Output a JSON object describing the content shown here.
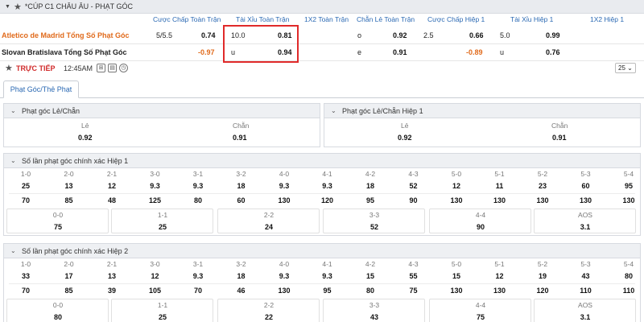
{
  "header": {
    "title": "*CÚP C1 CHÂU ÂU - PHẠT GÓC"
  },
  "columns": [
    "Cược Chấp Toàn Trận",
    "Tài Xỉu Toàn Trận",
    "1X2 Toàn Trận",
    "Chẵn Lẻ Toàn Trận",
    "Cược Chấp Hiệp 1",
    "Tài Xỉu Hiệp 1",
    "1X2 Hiệp 1"
  ],
  "matches": [
    {
      "team": "Atletico de Madrid Tổng Số Phạt Góc",
      "hdp_line": "5/5.5",
      "hdp_odd": "0.74",
      "ou_line": "10.0",
      "ou_odd": "0.81",
      "oe_label": "o",
      "oe_odd": "0.92",
      "h1_hdp_line": "2.5",
      "h1_hdp_odd": "0.66",
      "h1_ou_line": "5.0",
      "h1_ou_odd": "0.99"
    },
    {
      "team": "Slovan Bratislava Tổng Số Phạt Góc",
      "hdp_line": "",
      "hdp_odd": "-0.97",
      "ou_line": "u",
      "ou_odd": "0.94",
      "oe_label": "e",
      "oe_odd": "0.91",
      "h1_hdp_line": "",
      "h1_hdp_odd": "-0.89",
      "h1_ou_line": "u",
      "h1_ou_odd": "0.76"
    }
  ],
  "live": {
    "label": "TRỰC TIẾP",
    "time": "12:45AM",
    "page_size": "25"
  },
  "tab": {
    "label": "Phạt Góc/Thẻ Phạt"
  },
  "panel_oe_full": {
    "title": "Phạt góc Lẻ/Chẵn",
    "odd_label": "Lẻ",
    "even_label": "Chẵn",
    "odd_val": "0.92",
    "even_val": "0.91"
  },
  "panel_oe_h1": {
    "title": "Phạt góc Lẻ/Chẵn Hiệp 1",
    "odd_label": "Lẻ",
    "even_label": "Chẵn",
    "odd_val": "0.92",
    "even_val": "0.91"
  },
  "cs_h1": {
    "title": "Số lần phạt góc chính xác Hiệp 1",
    "headers": [
      "1-0",
      "2-0",
      "2-1",
      "3-0",
      "3-1",
      "3-2",
      "4-0",
      "4-1",
      "4-2",
      "4-3",
      "5-0",
      "5-1",
      "5-2",
      "5-3",
      "5-4"
    ],
    "row1": [
      "25",
      "13",
      "12",
      "9.3",
      "9.3",
      "18",
      "9.3",
      "9.3",
      "18",
      "52",
      "12",
      "11",
      "23",
      "60",
      "95"
    ],
    "row2": [
      "70",
      "85",
      "48",
      "125",
      "80",
      "60",
      "130",
      "120",
      "95",
      "90",
      "130",
      "130",
      "130",
      "130",
      "130"
    ],
    "draw_headers": [
      "0-0",
      "1-1",
      "2-2",
      "3-3",
      "4-4",
      "AOS"
    ],
    "draw_vals": [
      "75",
      "25",
      "24",
      "52",
      "90",
      "3.1"
    ]
  },
  "cs_h2": {
    "title": "Số lần phạt góc chính xác Hiệp 2",
    "headers": [
      "1-0",
      "2-0",
      "2-1",
      "3-0",
      "3-1",
      "3-2",
      "4-0",
      "4-1",
      "4-2",
      "4-3",
      "5-0",
      "5-1",
      "5-2",
      "5-3",
      "5-4"
    ],
    "row1": [
      "33",
      "17",
      "13",
      "12",
      "9.3",
      "18",
      "9.3",
      "9.3",
      "15",
      "55",
      "15",
      "12",
      "19",
      "43",
      "80"
    ],
    "row2": [
      "70",
      "85",
      "39",
      "105",
      "70",
      "46",
      "130",
      "95",
      "80",
      "75",
      "130",
      "130",
      "120",
      "110",
      "110"
    ],
    "draw_headers": [
      "0-0",
      "1-1",
      "2-2",
      "3-3",
      "4-4",
      "AOS"
    ],
    "draw_vals": [
      "80",
      "25",
      "22",
      "43",
      "75",
      "3.1"
    ]
  }
}
